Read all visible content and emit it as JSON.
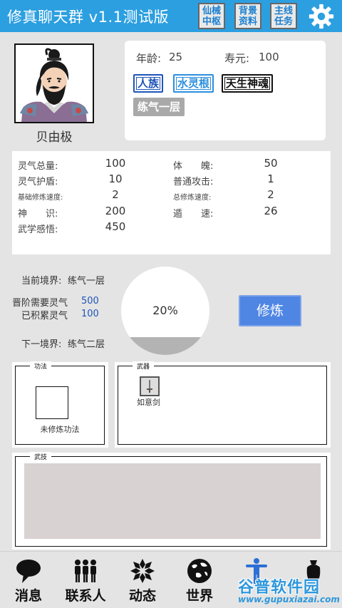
{
  "header": {
    "title": "修真聊天群 v1.1测试版",
    "buttons": [
      {
        "line1": "仙械",
        "line2": "中枢"
      },
      {
        "line1": "背景",
        "line2": "资料"
      },
      {
        "line1": "主线",
        "line2": "任务"
      }
    ],
    "settings_icon": "gear-icon",
    "accent_color": "#2c9fe0"
  },
  "profile": {
    "name": "贝由极",
    "age_label": "年龄:",
    "age": "25",
    "lifespan_label": "寿元:",
    "lifespan": "100",
    "tags": [
      "人族",
      "水灵根",
      "天生神魂"
    ],
    "level": "练气一层"
  },
  "stats": [
    {
      "label": "灵气总量:",
      "value": "100"
    },
    {
      "label": "体　　魄:",
      "value": "50"
    },
    {
      "label": "灵气护盾:",
      "value": "10"
    },
    {
      "label": "普通攻击:",
      "value": "1"
    },
    {
      "label": "基础修炼速度:",
      "value": "2"
    },
    {
      "label": "总修炼速度:",
      "value": "2"
    },
    {
      "label": "神　　识:",
      "value": "200"
    },
    {
      "label": "遁　　速:",
      "value": "26"
    },
    {
      "label": "武学感悟:",
      "value": "450"
    }
  ],
  "realm": {
    "current_label": "当前境界:",
    "current": "练气一层",
    "need_label": "晋阶需要灵气",
    "need": "500",
    "have_label": "已积累灵气",
    "have": "100",
    "next_label": "下一境界:",
    "next": "练气二层",
    "progress_text": "20%",
    "progress": 0.2,
    "cultivate_button": "修炼"
  },
  "panels": {
    "technique_title": "功法",
    "technique_empty": "未修炼功法",
    "weapon_title": "武器",
    "weapon_name": "如意剑",
    "martial_title": "武技"
  },
  "nav": [
    {
      "label": "消息",
      "icon": "speech-bubble-icon"
    },
    {
      "label": "联系人",
      "icon": "people-icon"
    },
    {
      "label": "动态",
      "icon": "snowflake-icon"
    },
    {
      "label": "世界",
      "icon": "globe-icon"
    },
    {
      "label": "",
      "icon": "person-stretch-icon"
    },
    {
      "label": "",
      "icon": "bag-icon"
    }
  ],
  "watermark": {
    "main": "谷普软件园",
    "sub": "www.gupuxiazai.com"
  }
}
